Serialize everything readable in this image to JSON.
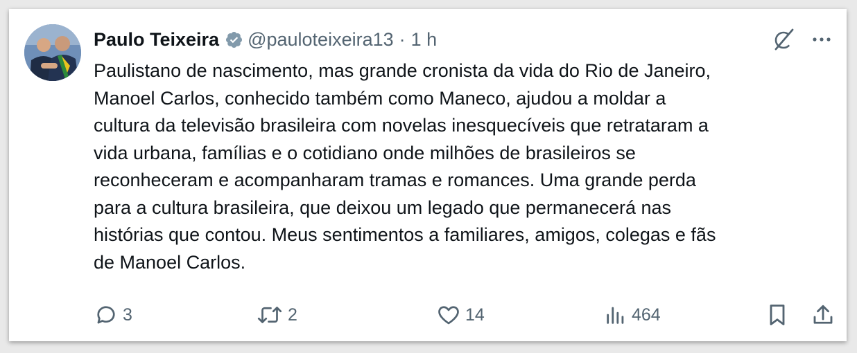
{
  "author": {
    "name": "Paulo Teixeira",
    "handle": "@pauloteixeira13",
    "separator": "·",
    "time": "1 h",
    "avatar_icon": "profile-photo"
  },
  "post": {
    "lines": [
      "Paulistano de nascimento, mas grande cronista da vida do Rio de Janeiro,",
      "Manoel Carlos, conhecido também como Maneco, ajudou a moldar a",
      "cultura da televisão brasileira com novelas inesquecíveis que retrataram a",
      "vida urbana, famílias e o cotidiano onde milhões de brasileiros se",
      "reconheceram e acompanharam tramas e romances. Uma grande perda",
      "para a cultura brasileira, que deixou um legado que permanecerá nas",
      "histórias que contou. Meus sentimentos a familiares, amigos, colegas e fãs",
      "de Manoel Carlos."
    ]
  },
  "actions": {
    "replies": "3",
    "reposts": "2",
    "likes": "14",
    "views": "464"
  },
  "colors": {
    "text": "#0f1419",
    "secondary": "#536471",
    "verified_badge": "#829aab"
  }
}
